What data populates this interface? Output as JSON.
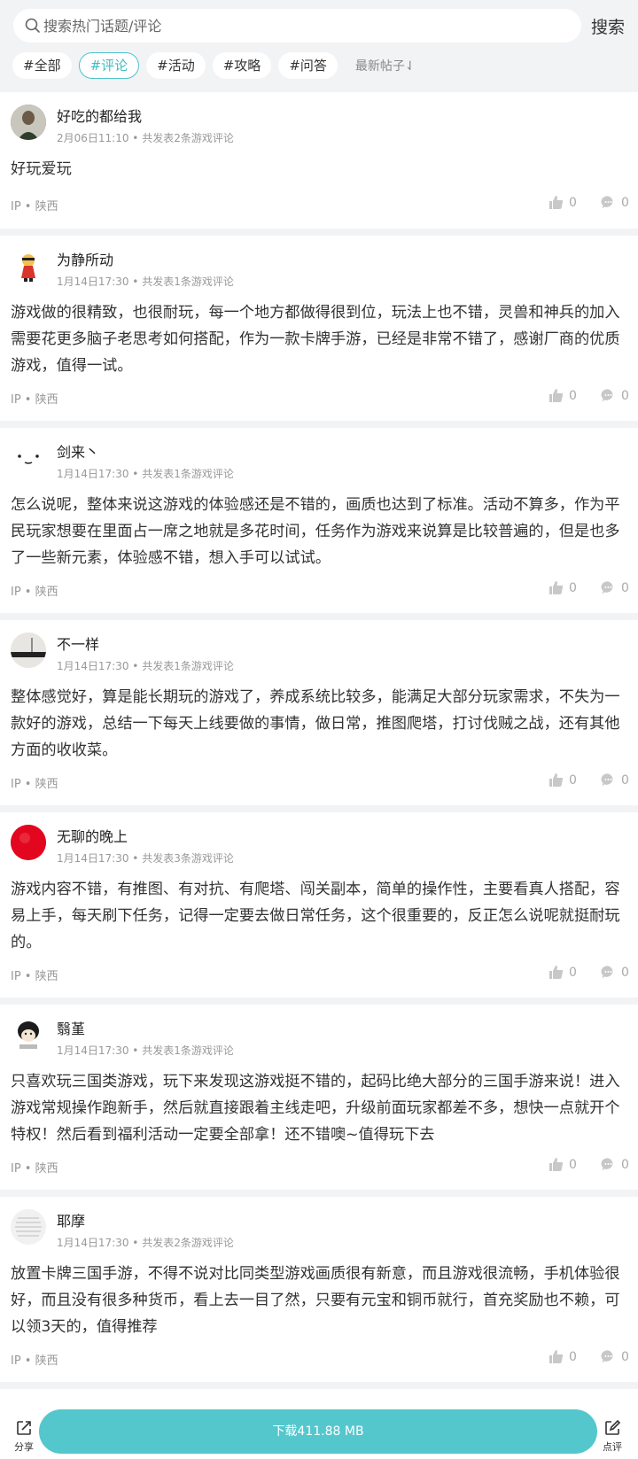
{
  "search": {
    "placeholder": "搜索热门话题/评论",
    "button": "搜索"
  },
  "tabs": [
    "#全部",
    "#评论",
    "#活动",
    "#攻略",
    "#问答"
  ],
  "sort_label": "最新帖子⇃",
  "posts": [
    {
      "author": "好吃的都给我",
      "meta": "2月06日11:10 • 共发表2条游戏评论",
      "body": "好玩爱玩",
      "ip": "IP • 陕西",
      "likes": "0",
      "comments": "0"
    },
    {
      "author": "为静所动",
      "meta": "1月14日17:30 • 共发表1条游戏评论",
      "body": "游戏做的很精致，也很耐玩，每一个地方都做得很到位，玩法上也不错，灵兽和神兵的加入需要花更多脑子老思考如何搭配，作为一款卡牌手游，已经是非常不错了，感谢厂商的优质游戏，值得一试。",
      "ip": "IP • 陕西",
      "likes": "0",
      "comments": "0"
    },
    {
      "author": "剑来丶",
      "meta": "1月14日17:30 • 共发表1条游戏评论",
      "body": "怎么说呢，整体来说这游戏的体验感还是不错的，画质也达到了标准。活动不算多，作为平民玩家想要在里面占一席之地就是多花时间，任务作为游戏来说算是比较普遍的，但是也多了一些新元素，体验感不错，想入手可以试试。",
      "ip": "IP • 陕西",
      "likes": "0",
      "comments": "0"
    },
    {
      "author": "不一样",
      "meta": "1月14日17:30 • 共发表1条游戏评论",
      "body": "整体感觉好，算是能长期玩的游戏了，养成系统比较多，能满足大部分玩家需求，不失为一款好的游戏，总结一下每天上线要做的事情，做日常，推图爬塔，打讨伐贼之战，还有其他方面的收收菜。",
      "ip": "IP • 陕西",
      "likes": "0",
      "comments": "0"
    },
    {
      "author": "无聊的晚上",
      "meta": "1月14日17:30 • 共发表3条游戏评论",
      "body": "游戏内容不错，有推图、有对抗、有爬塔、闯关副本，简单的操作性，主要看真人搭配，容易上手，每天刷下任务，记得一定要去做日常任务，这个很重要的，反正怎么说呢就挺耐玩的。",
      "ip": "IP • 陕西",
      "likes": "0",
      "comments": "0"
    },
    {
      "author": "翳堇",
      "meta": "1月14日17:30 • 共发表1条游戏评论",
      "body": "只喜欢玩三国类游戏，玩下来发现这游戏挺不错的，起码比绝大部分的三国手游来说！进入游戏常规操作跑新手，然后就直接跟着主线走吧，升级前面玩家都差不多，想快一点就开个特权！然后看到福利活动一定要全部拿！还不错噢~值得玩下去",
      "ip": "IP • 陕西",
      "likes": "0",
      "comments": "0"
    },
    {
      "author": "耶摩",
      "meta": "1月14日17:30 • 共发表2条游戏评论",
      "body": "放置卡牌三国手游，不得不说对比同类型游戏画质很有新意，而且游戏很流畅，手机体验很好，而且没有很多种货币，看上去一目了然，只要有元宝和铜币就行，首充奖励也不赖，可以领3天的，值得推荐",
      "ip": "IP • 陕西",
      "likes": "0",
      "comments": "0"
    }
  ],
  "bottom": {
    "share": "分享",
    "download": "下载411.88 MB",
    "review": "点评"
  },
  "colors": {
    "accent": "#54c7cd",
    "page_bg": "#f2f3f5"
  }
}
